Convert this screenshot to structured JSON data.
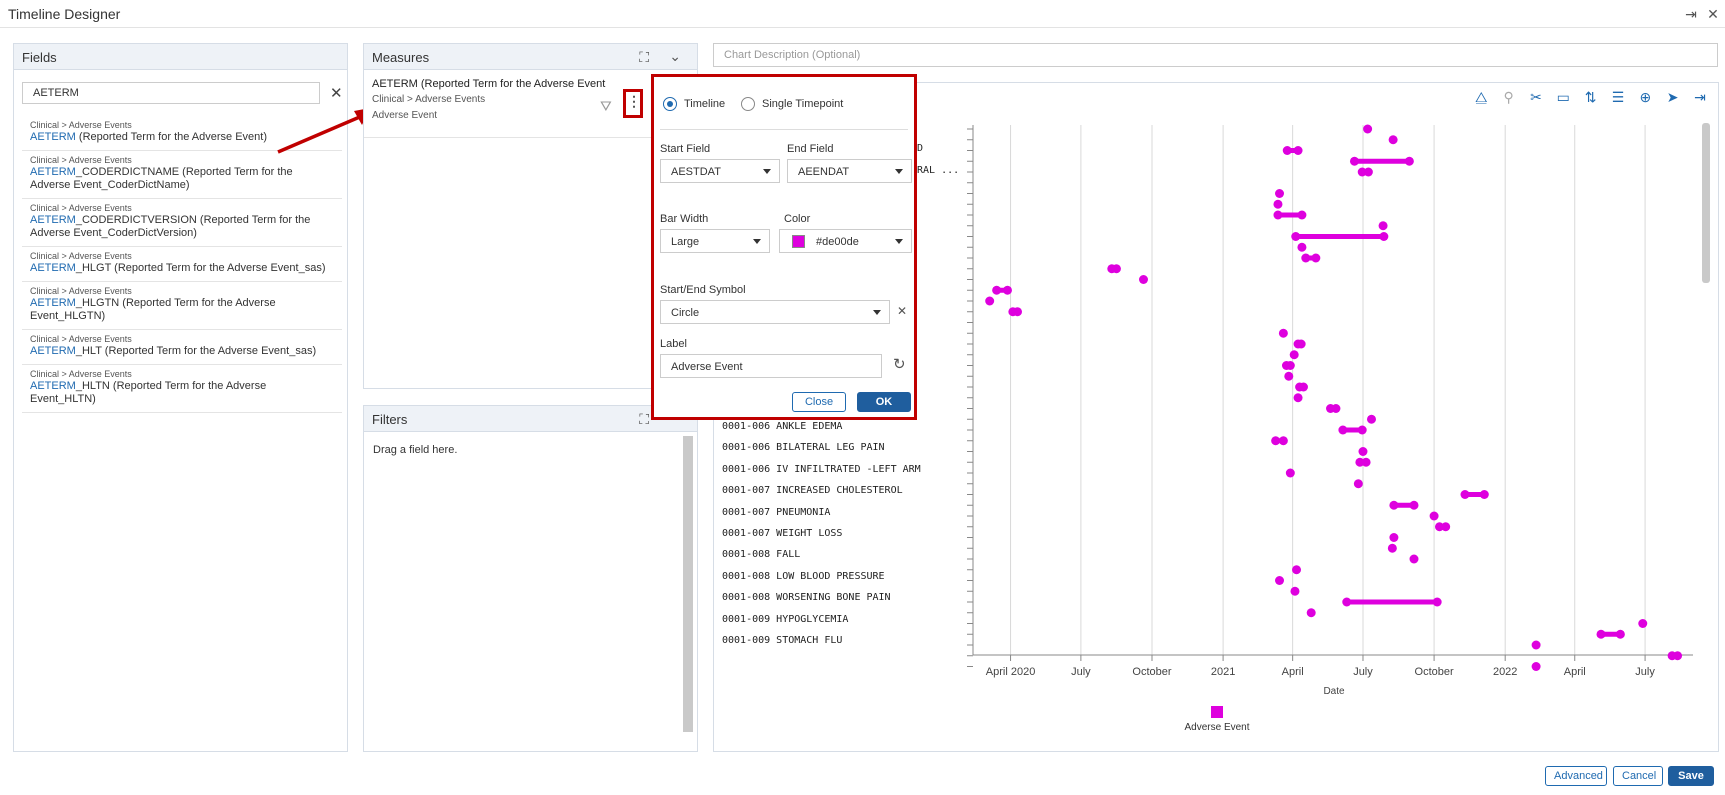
{
  "window": {
    "title": "Timeline Designer"
  },
  "fields": {
    "header": "Fields",
    "search_value": "AETERM",
    "items": [
      {
        "crumb": "Clinical > Adverse Events",
        "hl": "AETERM",
        "rest": " (Reported Term for the Adverse Event)"
      },
      {
        "crumb": "Clinical > Adverse Events",
        "hl": "AETERM",
        "rest": "_CODERDICTNAME (Reported Term for the Adverse Event_CoderDictName)"
      },
      {
        "crumb": "Clinical > Adverse Events",
        "hl": "AETERM",
        "rest": "_CODERDICTVERSION (Reported Term for the Adverse Event_CoderDictVersion)"
      },
      {
        "crumb": "Clinical > Adverse Events",
        "hl": "AETERM",
        "rest": "_HLGT (Reported Term for the Adverse Event_sas)"
      },
      {
        "crumb": "Clinical > Adverse Events",
        "hl": "AETERM",
        "rest": "_HLGTN (Reported Term for the Adverse Event_HLGTN)"
      },
      {
        "crumb": "Clinical > Adverse Events",
        "hl": "AETERM",
        "rest": "_HLT (Reported Term for the Adverse Event_sas)"
      },
      {
        "crumb": "Clinical > Adverse Events",
        "hl": "AETERM",
        "rest": "_HLTN (Reported Term for the Adverse Event_HLTN)"
      }
    ]
  },
  "measures": {
    "header": "Measures",
    "item": {
      "title": "AETERM (Reported Term for the Adverse Event",
      "crumb": "Clinical > Adverse Events",
      "label": "Adverse Event"
    }
  },
  "filters": {
    "header": "Filters",
    "placeholder": "Drag a field here."
  },
  "chart": {
    "description_placeholder": "Chart Description (Optional)",
    "partial_labels": [
      "ED",
      "ERAL ..."
    ],
    "legend": "Adverse Event",
    "color": "#de00de"
  },
  "popup": {
    "timeline_label": "Timeline",
    "single_label": "Single Timepoint",
    "start_field_label": "Start Field",
    "start_field_value": "AESTDAT",
    "end_field_label": "End Field",
    "end_field_value": "AEENDAT",
    "bar_width_label": "Bar Width",
    "bar_width_value": "Large",
    "color_label": "Color",
    "color_value": "#de00de",
    "symbol_label": "Start/End Symbol",
    "symbol_value": "Circle",
    "label_label": "Label",
    "label_value": "Adverse Event",
    "close_label": "Close",
    "ok_label": "OK"
  },
  "footer": {
    "advanced": "Advanced",
    "cancel": "Cancel",
    "save": "Save"
  },
  "chart_data": {
    "type": "scatter",
    "xlabel": "Date",
    "x_ticks": [
      "April 2020",
      "July",
      "October",
      "2021",
      "April",
      "July",
      "October",
      "2022",
      "April",
      "July"
    ],
    "x_tick_dates": [
      "2020-04-01",
      "2020-07-01",
      "2020-10-01",
      "2021-01-01",
      "2021-04-01",
      "2021-07-01",
      "2021-10-01",
      "2022-01-01",
      "2022-04-01",
      "2022-07-01"
    ],
    "xlim": [
      "2020-02-15",
      "2022-09-01"
    ],
    "series": [
      {
        "name": "Adverse Event",
        "color": "#de00de"
      }
    ],
    "categories": [
      "0001-006 ANKLE EDEMA",
      "0001-006 BILATERAL LEG PAIN",
      "0001-006 IV INFILTRATED -LEFT ARM",
      "0001-007 INCREASED CHOLESTEROL",
      "0001-007 PNEUMONIA",
      "0001-007 WEIGHT LOSS",
      "0001-008 FALL",
      "0001-008 LOW BLOOD PRESSURE",
      "0001-008 WORSENING BONE PAIN",
      "0001-009 HYPOGLYCEMIA",
      "0001-009 STOMACH FLU"
    ],
    "events": [
      {
        "row": 0,
        "start": "2021-07-07",
        "end": "2021-07-07"
      },
      {
        "row": 1,
        "start": "2021-08-09",
        "end": "2021-08-09"
      },
      {
        "row": 2,
        "start": "2021-03-25",
        "end": "2021-04-08"
      },
      {
        "row": 3,
        "start": "2021-06-20",
        "end": "2021-08-30"
      },
      {
        "row": 4,
        "start": "2021-06-30",
        "end": "2021-07-08"
      },
      {
        "row": 6,
        "start": "2021-03-15",
        "end": "2021-03-15"
      },
      {
        "row": 7,
        "start": "2021-03-13",
        "end": "2021-03-13"
      },
      {
        "row": 8,
        "start": "2021-03-13",
        "end": "2021-04-13"
      },
      {
        "row": 9,
        "start": "2021-07-27",
        "end": "2021-07-27"
      },
      {
        "row": 10,
        "start": "2021-04-05",
        "end": "2021-07-28"
      },
      {
        "row": 11,
        "start": "2021-04-13",
        "end": "2021-04-13"
      },
      {
        "row": 12,
        "start": "2021-04-18",
        "end": "2021-05-01"
      },
      {
        "row": 13,
        "start": "2020-08-10",
        "end": "2020-08-16"
      },
      {
        "row": 14,
        "start": "2020-09-20",
        "end": "2020-09-20"
      },
      {
        "row": 15,
        "start": "2020-03-14",
        "end": "2020-03-28"
      },
      {
        "row": 16,
        "start": "2020-03-05",
        "end": "2020-03-05"
      },
      {
        "row": 17,
        "start": "2020-04-04",
        "end": "2020-04-10"
      },
      {
        "row": 19,
        "start": "2021-03-20",
        "end": "2021-03-20"
      },
      {
        "row": 20,
        "start": "2021-04-08",
        "end": "2021-04-12"
      },
      {
        "row": 21,
        "start": "2021-04-03",
        "end": "2021-04-03"
      },
      {
        "row": 22,
        "start": "2021-03-24",
        "end": "2021-03-29"
      },
      {
        "row": 23,
        "start": "2021-03-27",
        "end": "2021-03-27"
      },
      {
        "row": 24,
        "start": "2021-04-10",
        "end": "2021-04-15"
      },
      {
        "row": 25,
        "start": "2021-04-08",
        "end": "2021-04-08"
      },
      {
        "row": 26,
        "start": "2021-05-20",
        "end": "2021-05-27"
      },
      {
        "row": 27,
        "start": "2021-07-12",
        "end": "2021-07-12"
      },
      {
        "row": 28,
        "start": "2021-06-05",
        "end": "2021-06-30"
      },
      {
        "row": 29,
        "start": "2021-03-10",
        "end": "2021-03-20"
      },
      {
        "row": 30,
        "start": "2021-07-01",
        "end": "2021-07-01"
      },
      {
        "row": 31,
        "start": "2021-06-27",
        "end": "2021-07-05"
      },
      {
        "row": 32,
        "start": "2021-03-29",
        "end": "2021-03-29"
      },
      {
        "row": 33,
        "start": "2021-06-25",
        "end": "2021-06-25"
      },
      {
        "row": 34,
        "start": "2021-11-10",
        "end": "2021-12-05"
      },
      {
        "row": 35,
        "start": "2021-08-10",
        "end": "2021-09-05"
      },
      {
        "row": 36,
        "start": "2021-10-01",
        "end": "2021-10-01"
      },
      {
        "row": 37,
        "start": "2021-10-08",
        "end": "2021-10-16"
      },
      {
        "row": 38,
        "start": "2021-08-10",
        "end": "2021-08-10"
      },
      {
        "row": 39,
        "start": "2021-08-08",
        "end": "2021-08-08"
      },
      {
        "row": 40,
        "start": "2021-09-05",
        "end": "2021-09-05"
      },
      {
        "row": 41,
        "start": "2021-04-06",
        "end": "2021-04-06"
      },
      {
        "row": 42,
        "start": "2021-03-15",
        "end": "2021-03-15"
      },
      {
        "row": 43,
        "start": "2021-04-04",
        "end": "2021-04-04"
      },
      {
        "row": 44,
        "start": "2021-06-10",
        "end": "2021-10-05"
      },
      {
        "row": 45,
        "start": "2021-04-25",
        "end": "2021-04-25"
      },
      {
        "row": 46,
        "start": "2022-06-28",
        "end": "2022-06-28"
      },
      {
        "row": 47,
        "start": "2022-05-05",
        "end": "2022-05-30"
      },
      {
        "row": 48,
        "start": "2022-02-10",
        "end": "2022-02-10"
      },
      {
        "row": 49,
        "start": "2022-08-05",
        "end": "2022-08-12"
      },
      {
        "row": 50,
        "start": "2022-02-10",
        "end": "2022-02-10"
      }
    ]
  }
}
